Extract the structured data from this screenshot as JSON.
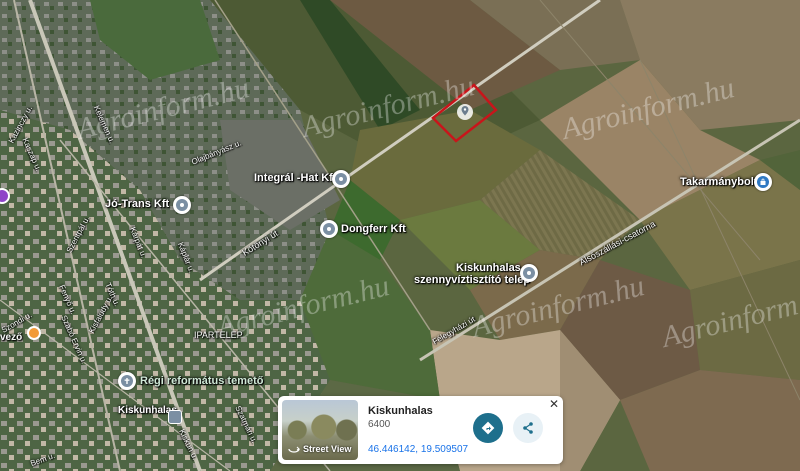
{
  "watermark": "Agroinform.hu",
  "places": [
    {
      "name": "Integrál -Hat Kft"
    },
    {
      "name": "Jó-Trans Kft"
    },
    {
      "name": "Dongferr Kft"
    },
    {
      "name": "Kiskunhalas"
    },
    {
      "name": "szennyvíztisztító telep"
    },
    {
      "name": "Takarmánybolt"
    },
    {
      "name": "Régi református temető"
    },
    {
      "name": "IPARTELEP"
    },
    {
      "name": "Kiskunhalas"
    }
  ],
  "streets": {
    "kotonyi": "Kötönyi út",
    "alsoszallasi": "Alsószállási-csatorna",
    "felegyhazi": "Félegyházi út",
    "olajbanyasz": "Olajbányász u.",
    "szentpal": "Szentpál u.",
    "karpat": "Kárpát u.",
    "kaplar": "Káplár u.",
    "kaszap": "Kaszap u.",
    "toth": "Tóth u.",
    "fenyo": "Fenyő u.",
    "bem": "Bem u.",
    "szabo": "Szabó Ervin u.",
    "szatmar": "Szatmári u.",
    "kiskun": "Kiskun u.",
    "vezo": "vező",
    "szondi": "Szondi u.",
    "kazinczy": "Kazinczy u.",
    "kelemen": "Kelemen u.",
    "kisfaludy": "Kisfaludy u."
  },
  "card": {
    "title": "Kiskunhalas",
    "zip": "6400",
    "coords": "46.446142, 19.509507",
    "street_view": "Street View"
  },
  "colors": {
    "parcel_outline": "#c8151b",
    "directions_button": "#1e6f8c",
    "coords_link": "#1a73e8"
  },
  "icons": [
    "location-pin-icon",
    "shopping-bag-icon",
    "cemetery-icon",
    "directions-icon",
    "share-icon",
    "close-icon",
    "street-view-icon"
  ]
}
